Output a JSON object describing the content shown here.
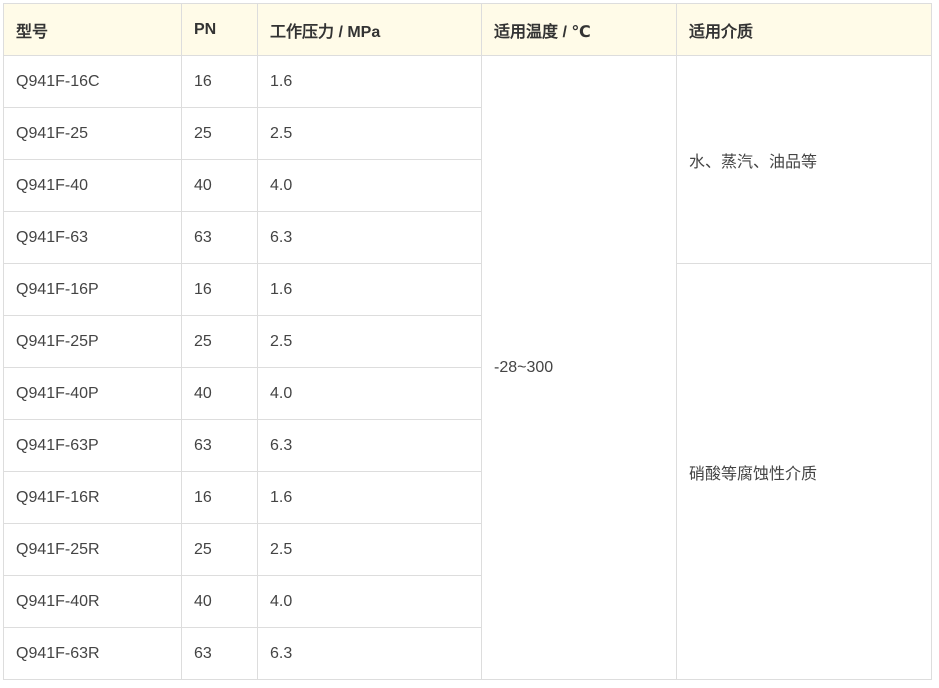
{
  "table": {
    "headers": [
      "型号",
      "PN",
      "工作压力 / MPa",
      "适用温度 / ℃",
      "适用介质"
    ],
    "rows": [
      [
        "Q941F-16C",
        "16",
        "1.6"
      ],
      [
        "Q941F-25",
        "25",
        "2.5"
      ],
      [
        "Q941F-40",
        "40",
        "4.0"
      ],
      [
        "Q941F-63",
        "63",
        "6.3"
      ],
      [
        "Q941F-16P",
        "16",
        "1.6"
      ],
      [
        "Q941F-25P",
        "25",
        "2.5"
      ],
      [
        "Q941F-40P",
        "40",
        "4.0"
      ],
      [
        "Q941F-63P",
        "63",
        "6.3"
      ],
      [
        "Q941F-16R",
        "16",
        "1.6"
      ],
      [
        "Q941F-25R",
        "25",
        "2.5"
      ],
      [
        "Q941F-40R",
        "40",
        "4.0"
      ],
      [
        "Q941F-63R",
        "63",
        "6.3"
      ]
    ],
    "temperature": "-28~300",
    "media": [
      "水、蒸汽、油品等",
      "硝酸等腐蚀性介质"
    ],
    "colors": {
      "header_bg": "#fffbe8",
      "border": "#dddddd",
      "text": "#333333"
    }
  }
}
